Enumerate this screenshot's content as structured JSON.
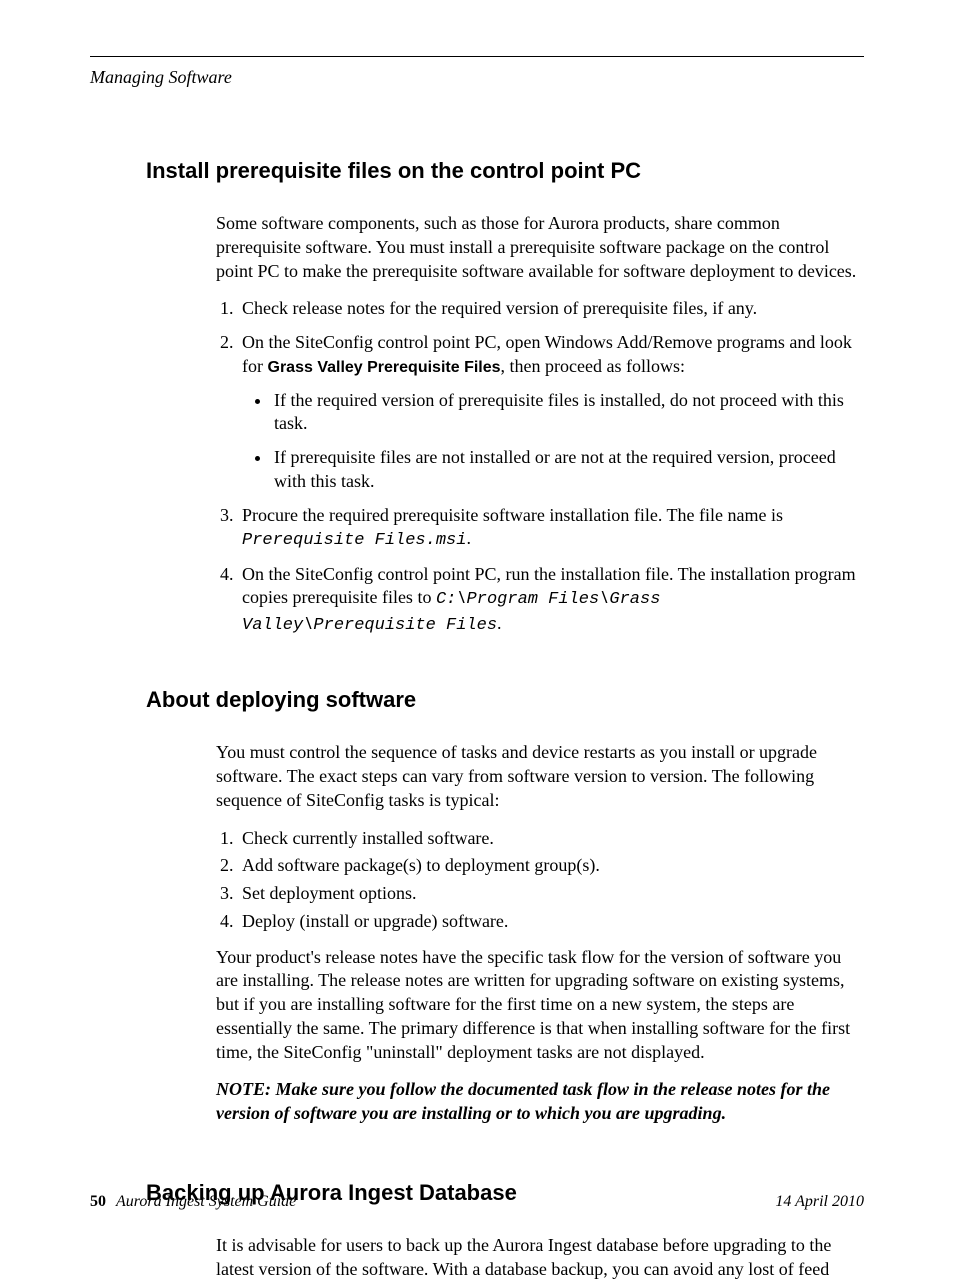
{
  "header": {
    "running": "Managing Software"
  },
  "s1": {
    "title": "Install prerequisite files on the control point PC",
    "intro": "Some software components, such as those for Aurora products, share common prerequisite software. You must install a prerequisite software package on the control point PC to make the prerequisite software available for software deployment to devices.",
    "li1": "Check release notes for the required version of prerequisite files, if any.",
    "li2_a": "On the SiteConfig control point PC, open Windows Add/Remove programs and look for ",
    "li2_bold": "Grass Valley Prerequisite Files",
    "li2_b": ", then proceed as follows:",
    "li2_sub1": "If the required version of prerequisite files is installed, do not proceed with this task.",
    "li2_sub2": "If prerequisite files are not installed or are not at the required version, proceed with this task.",
    "li3_a": "Procure the required prerequisite software installation file. The file name is ",
    "li3_mono": "Prerequisite Files.msi",
    "li3_b": ".",
    "li4_a": "On the SiteConfig control point PC, run the installation file. The installation program copies prerequisite files to ",
    "li4_mono": "C:\\Program Files\\Grass Valley\\Prerequisite Files",
    "li4_b": "."
  },
  "s2": {
    "title": "About deploying software",
    "intro": "You must control the sequence of  tasks and device restarts as you install or upgrade software. The exact steps can vary from software version to version. The following sequence of SiteConfig tasks is typical:",
    "li1": "Check currently installed software.",
    "li2": "Add software package(s) to deployment group(s).",
    "li3": "Set deployment options.",
    "li4": "Deploy (install or upgrade) software.",
    "p2": "Your product's release notes have the specific task flow for the version of software you are installing. The release notes are written for upgrading software on existing systems, but if you are installing software for the first time on a new system, the steps are essentially the same. The primary difference is that when installing software for the first time, the SiteConfig \"uninstall\" deployment tasks are not displayed.",
    "note": "NOTE:  Make sure you follow the documented task flow in the release notes for the version of software you are installing or to which you are upgrading."
  },
  "s3": {
    "title": "Backing up Aurora Ingest Database",
    "intro": "It is advisable for users to back up the Aurora Ingest database before upgrading to the latest version of the software. With a database backup, you can avoid any lost of feed"
  },
  "footer": {
    "page": "50",
    "book": "Aurora Ingest System Guide",
    "date": "14 April 2010"
  }
}
